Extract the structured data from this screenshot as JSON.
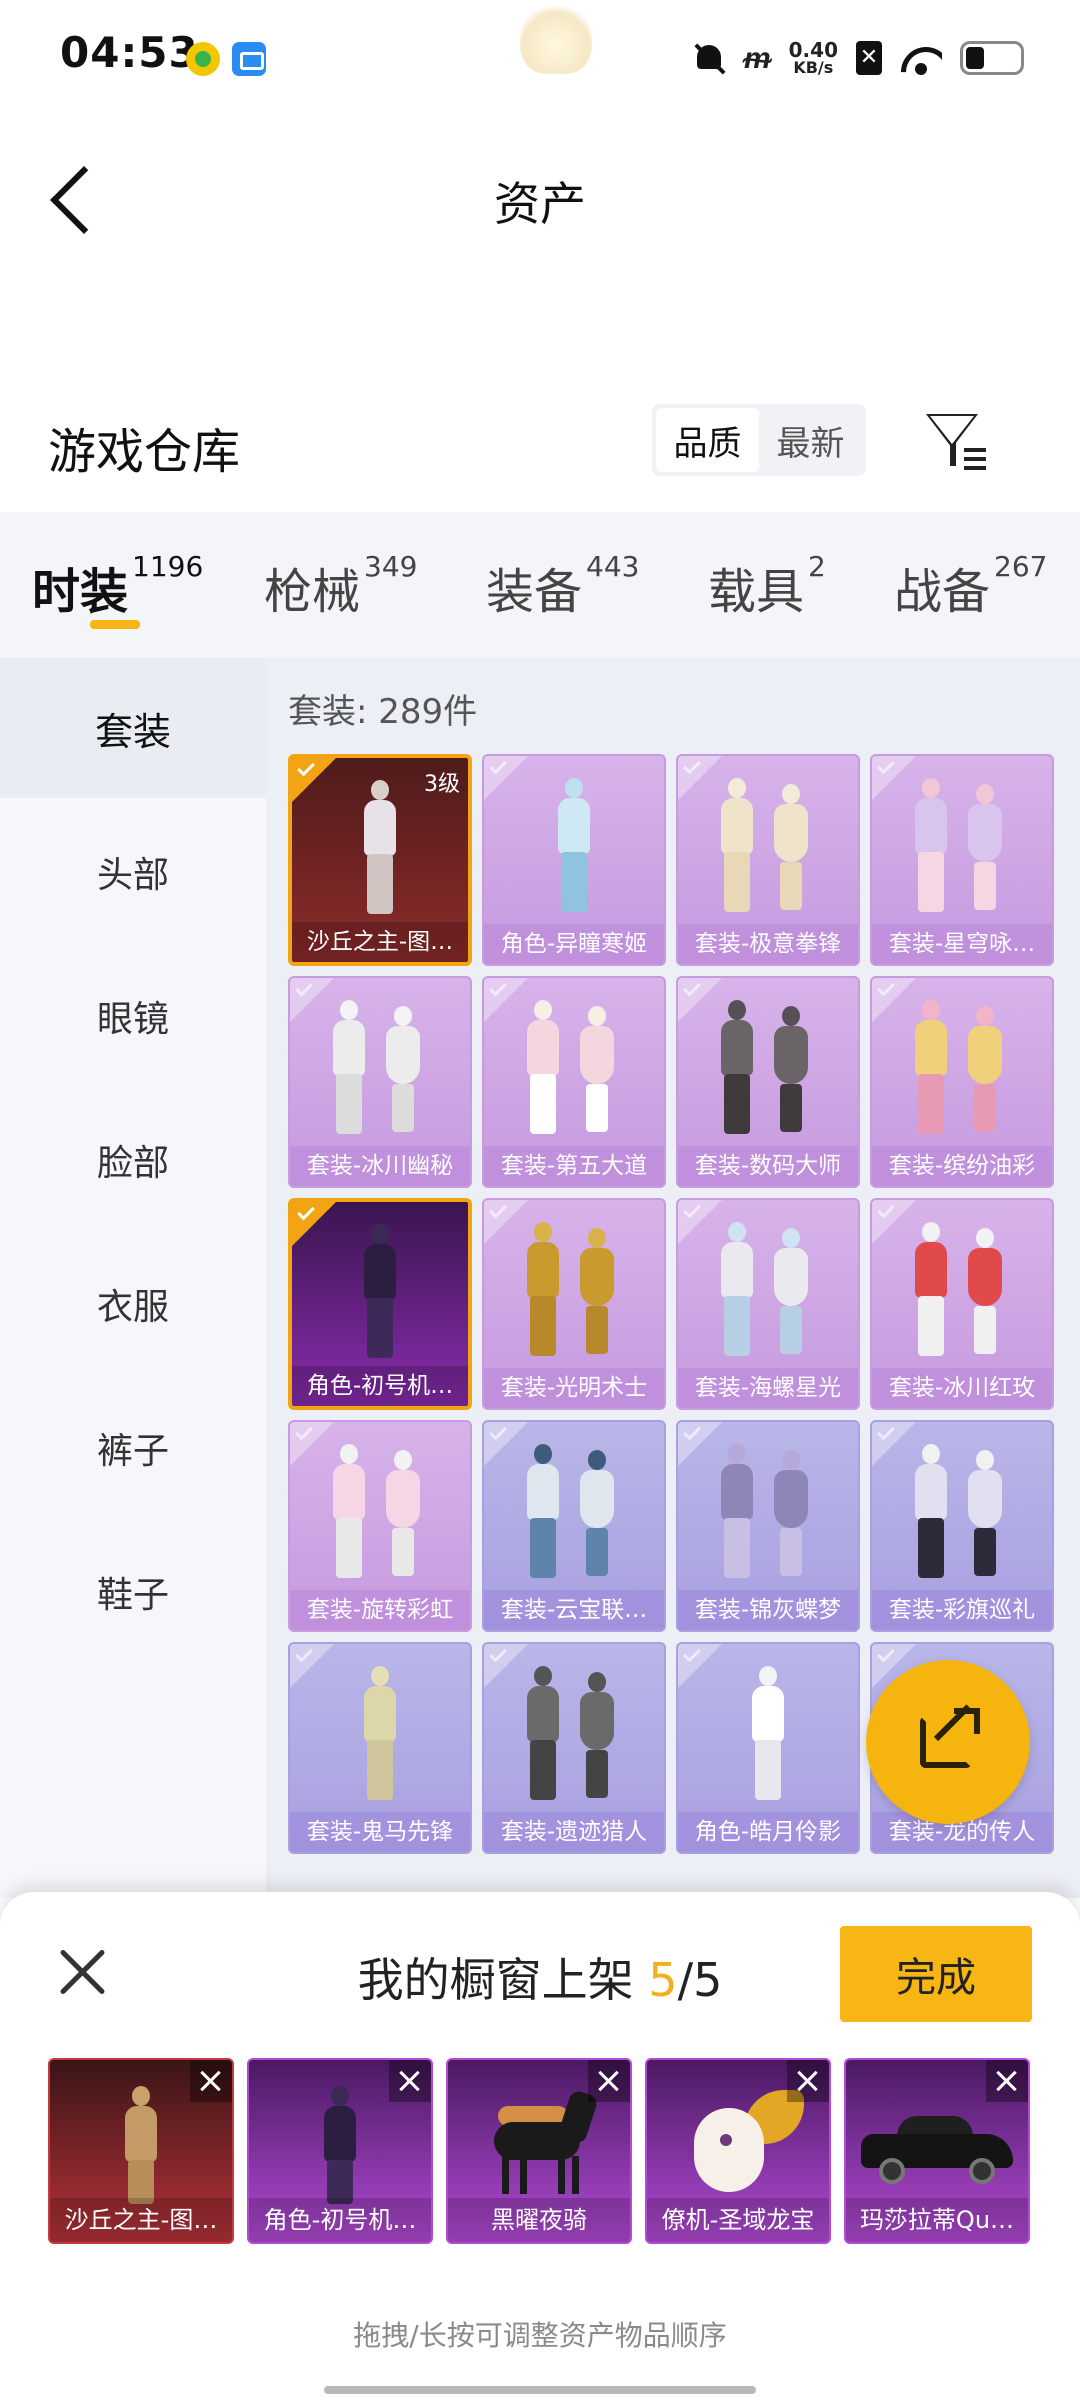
{
  "status_bar": {
    "time": "04:53",
    "speed_value": "0.40",
    "speed_unit": "KB/s"
  },
  "header": {
    "title": "资产"
  },
  "warehouse": {
    "title": "游戏仓库",
    "sort_options": [
      "品质",
      "最新"
    ],
    "active_sort": "品质"
  },
  "category_tabs": [
    {
      "label": "时装",
      "count": "1196",
      "active": true
    },
    {
      "label": "枪械",
      "count": "349"
    },
    {
      "label": "装备",
      "count": "443"
    },
    {
      "label": "载具",
      "count": "2"
    },
    {
      "label": "战备",
      "count": "267"
    }
  ],
  "subnav": [
    {
      "label": "套装",
      "active": true
    },
    {
      "label": "头部"
    },
    {
      "label": "眼镜"
    },
    {
      "label": "脸部"
    },
    {
      "label": "衣服"
    },
    {
      "label": "裤子"
    },
    {
      "label": "鞋子"
    }
  ],
  "grid": {
    "count_label": "套装: 289件",
    "items": [
      {
        "label": "沙丘之主-图…",
        "selected": true,
        "level": "3级",
        "style": "selected-red"
      },
      {
        "label": "角色-异瞳寒姬",
        "style": "purple"
      },
      {
        "label": "套装-极意拳锋",
        "style": "purple"
      },
      {
        "label": "套装-星穹咏…",
        "style": "purple"
      },
      {
        "label": "套装-冰川幽秘",
        "style": "purple"
      },
      {
        "label": "套装-第五大道",
        "style": "purple"
      },
      {
        "label": "套装-数码大师",
        "style": "purple"
      },
      {
        "label": "套装-缤纷油彩",
        "style": "purple"
      },
      {
        "label": "角色-初号机…",
        "selected": true,
        "style": "selected-purple"
      },
      {
        "label": "套装-光明术士",
        "style": "purple"
      },
      {
        "label": "套装-海螺星光",
        "style": "purple"
      },
      {
        "label": "套装-冰川红玫",
        "style": "purple"
      },
      {
        "label": "套装-旋转彩虹",
        "style": "purple"
      },
      {
        "label": "套装-云宝联…",
        "style": "blue"
      },
      {
        "label": "套装-锦灰蝶梦",
        "style": "blue"
      },
      {
        "label": "套装-彩旗巡礼",
        "style": "blue"
      },
      {
        "label": "套装-鬼马先锋",
        "style": "blue"
      },
      {
        "label": "套装-遗迹猎人",
        "style": "blue"
      },
      {
        "label": "角色-皓月伶影",
        "style": "blue"
      },
      {
        "label": "套装-龙的传人",
        "style": "blue"
      }
    ]
  },
  "sheet": {
    "title_prefix": "我的橱窗上架",
    "count_current": "5",
    "count_sep": "/",
    "count_max": "5",
    "done_label": "完成",
    "hint": "拖拽/长按可调整资产物品顺序",
    "shelf_items": [
      {
        "label": "沙丘之主-图…",
        "style": "red"
      },
      {
        "label": "角色-初号机…",
        "style": "purple"
      },
      {
        "label": "黑曜夜骑",
        "style": "purple"
      },
      {
        "label": "僚机-圣域龙宝",
        "style": "purple"
      },
      {
        "label": "玛莎拉蒂Qu…",
        "style": "purple"
      }
    ]
  }
}
